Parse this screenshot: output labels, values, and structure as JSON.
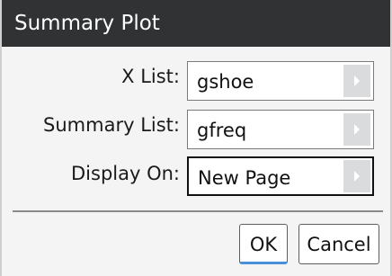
{
  "dialog": {
    "title": "Summary Plot",
    "fields": [
      {
        "label": "X List:",
        "value": "gshoe"
      },
      {
        "label": "Summary List:",
        "value": "gfreq"
      },
      {
        "label": "Display On:",
        "value": "New Page"
      }
    ],
    "ok_label": "OK",
    "cancel_label": "Cancel"
  },
  "colors": {
    "titlebar_bg": "#313233",
    "dialog_bg": "#f4f4f4",
    "default_button_accent": "#4a90d9"
  },
  "icons": {
    "dropdown_arrow": "chevron-right-icon"
  }
}
